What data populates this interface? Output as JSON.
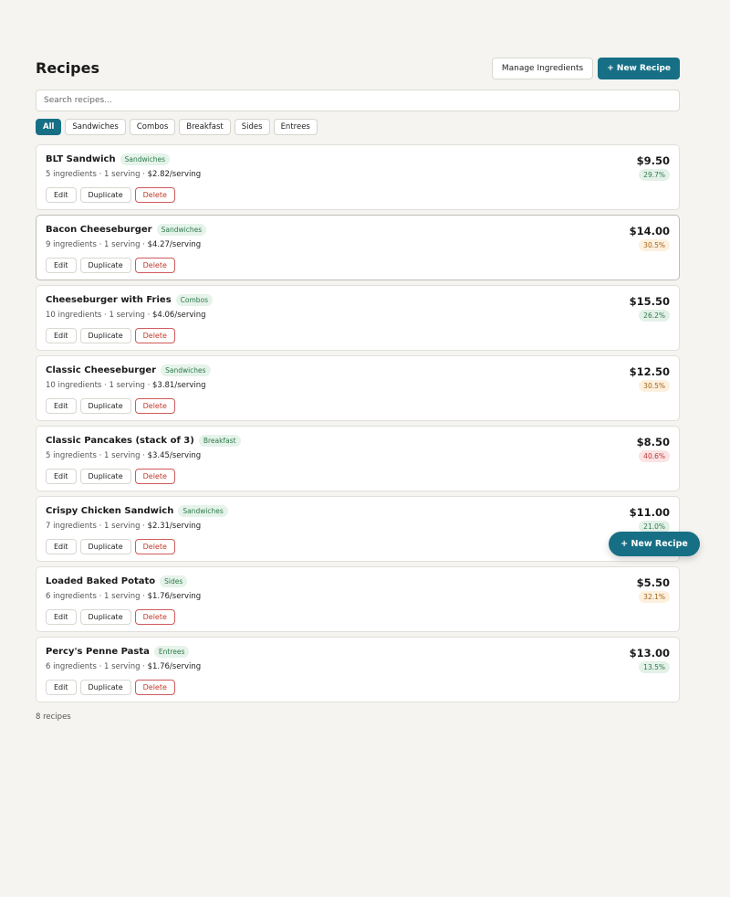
{
  "page": {
    "title": "Recipes",
    "manage_label": "Manage Ingredients",
    "new_label": "+ New Recipe",
    "fab_label": "+ New Recipe",
    "count_label": "8 recipes"
  },
  "search": {
    "placeholder": "Search recipes...",
    "value": ""
  },
  "filters": [
    "All",
    "Sandwiches",
    "Combos",
    "Breakfast",
    "Sides",
    "Entrees"
  ],
  "active_filter": "All",
  "actions": {
    "edit": "Edit",
    "duplicate": "Duplicate",
    "delete": "Delete"
  },
  "recipes": [
    {
      "name": "BLT Sandwich",
      "category": "Sandwiches",
      "ingredients": "5 ingredients",
      "servings": "1 serving",
      "cost": "$2.82/serving",
      "price": "$9.50",
      "pct": "29.7%",
      "status": "good"
    },
    {
      "name": "Bacon Cheeseburger",
      "category": "Sandwiches",
      "ingredients": "9 ingredients",
      "servings": "1 serving",
      "cost": "$4.27/serving",
      "price": "$14.00",
      "pct": "30.5%",
      "status": "warn"
    },
    {
      "name": "Cheeseburger with Fries",
      "category": "Combos",
      "ingredients": "10 ingredients",
      "servings": "1 serving",
      "cost": "$4.06/serving",
      "price": "$15.50",
      "pct": "26.2%",
      "status": "good"
    },
    {
      "name": "Classic Cheeseburger",
      "category": "Sandwiches",
      "ingredients": "10 ingredients",
      "servings": "1 serving",
      "cost": "$3.81/serving",
      "price": "$12.50",
      "pct": "30.5%",
      "status": "warn"
    },
    {
      "name": "Classic Pancakes (stack of 3)",
      "category": "Breakfast",
      "ingredients": "5 ingredients",
      "servings": "1 serving",
      "cost": "$3.45/serving",
      "price": "$8.50",
      "pct": "40.6%",
      "status": "bad"
    },
    {
      "name": "Crispy Chicken Sandwich",
      "category": "Sandwiches",
      "ingredients": "7 ingredients",
      "servings": "1 serving",
      "cost": "$2.31/serving",
      "price": "$11.00",
      "pct": "21.0%",
      "status": "good"
    },
    {
      "name": "Loaded Baked Potato",
      "category": "Sides",
      "ingredients": "6 ingredients",
      "servings": "1 serving",
      "cost": "$1.76/serving",
      "price": "$5.50",
      "pct": "32.1%",
      "status": "warn"
    },
    {
      "name": "Percy's Penne Pasta",
      "category": "Entrees",
      "ingredients": "6 ingredients",
      "servings": "1 serving",
      "cost": "$1.76/serving",
      "price": "$13.00",
      "pct": "13.5%",
      "status": "good"
    }
  ],
  "colors": {
    "accent": "#176f85",
    "good": "#2f7a4c",
    "warn": "#a36418",
    "bad": "#b83a3a"
  }
}
